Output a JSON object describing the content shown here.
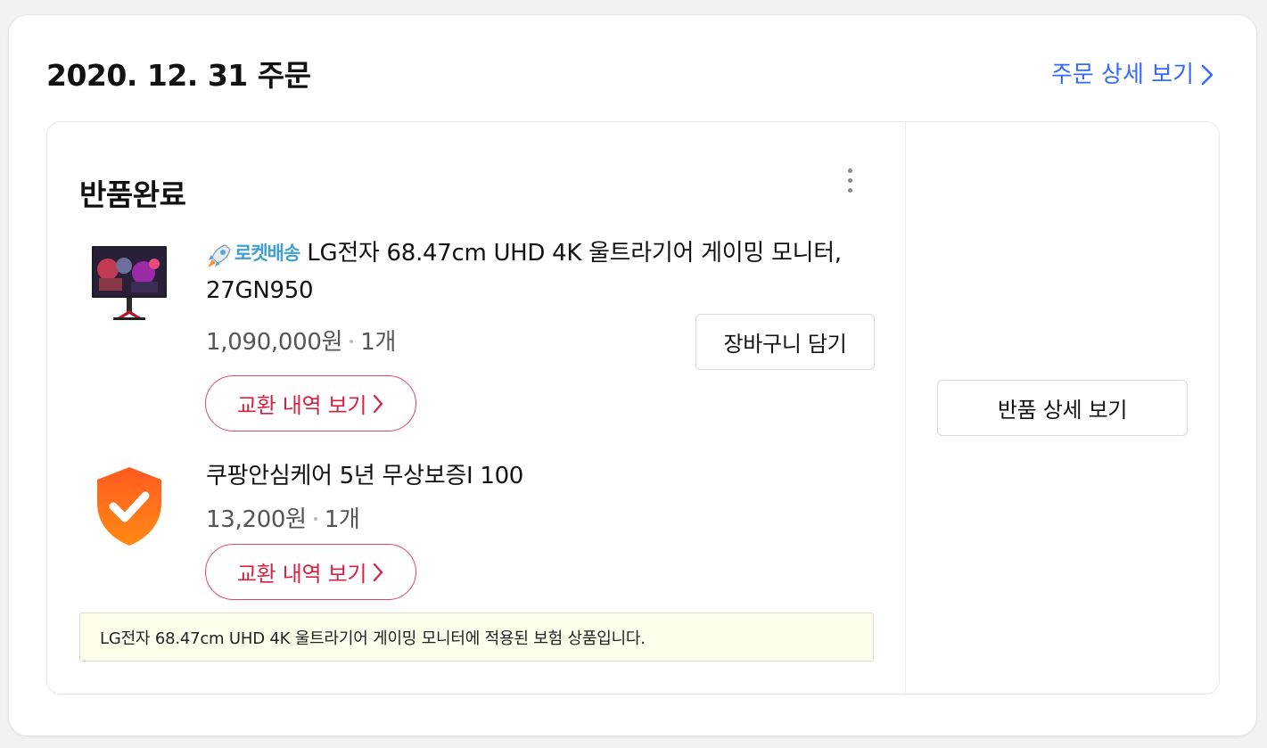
{
  "order": {
    "date_title": "2020. 12. 31 주문",
    "detail_link": "주문 상세 보기"
  },
  "status": {
    "title": "반품완료"
  },
  "product": {
    "badge": "로켓배송",
    "name": "LG전자 68.47cm UHD 4K 울트라기어 게이밍 모니터, 27GN950",
    "price": "1,090,000원",
    "quantity": "1개",
    "cart_button": "장바구니 담기",
    "exchange_button": "교환 내역 보기"
  },
  "care": {
    "name": "쿠팡안심케어 5년 무상보증I 100",
    "price": "13,200원",
    "quantity": "1개",
    "exchange_button": "교환 내역 보기"
  },
  "notice": {
    "text": "LG전자 68.47cm UHD 4K 울트라기어 게이밍 모니터에 적용된 보험 상품입니다."
  },
  "return_detail_button": "반품 상세 보기",
  "colors": {
    "link": "#346aff",
    "exchange": "#d8213f",
    "rocket": "#3fa1cf",
    "notice_bg": "#fffdeb",
    "shield": "#ff6a1a"
  },
  "icons": [
    "chevron-right-icon",
    "more-vertical-icon",
    "rocket-icon",
    "monitor-thumbnail",
    "shield-check-icon"
  ]
}
